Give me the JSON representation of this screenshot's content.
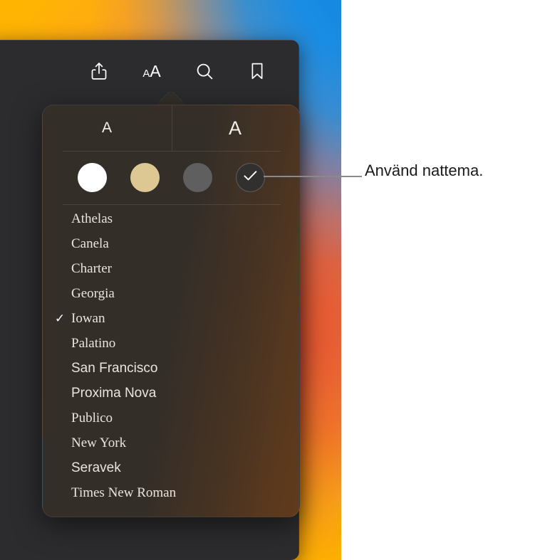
{
  "window": {
    "toolbar": {
      "buttons": [
        {
          "name": "share-icon",
          "label": "Dela"
        },
        {
          "name": "text-size-icon",
          "label": "aA"
        },
        {
          "name": "search-icon",
          "label": "Sök"
        },
        {
          "name": "bookmark-icon",
          "label": "Bokmärke"
        }
      ]
    }
  },
  "popover": {
    "size_controls": {
      "decrease_label": "A",
      "increase_label": "A"
    },
    "themes": [
      {
        "name": "white",
        "label": "Vit",
        "color": "#ffffff",
        "selected": false
      },
      {
        "name": "sepia",
        "label": "Sepia",
        "color": "#ddc893",
        "selected": false
      },
      {
        "name": "gray",
        "label": "Grå",
        "color": "#5f5f5f",
        "selected": false
      },
      {
        "name": "night",
        "label": "Natt",
        "color": "#31302e",
        "selected": true
      }
    ],
    "selected_theme": "night",
    "selected_font": "Iowan",
    "check_glyph": "✓",
    "fonts": [
      {
        "label": "Athelas",
        "style": "serif",
        "selected": false
      },
      {
        "label": "Canela",
        "style": "serif",
        "selected": false
      },
      {
        "label": "Charter",
        "style": "serif",
        "selected": false
      },
      {
        "label": "Georgia",
        "style": "serif",
        "selected": false
      },
      {
        "label": "Iowan",
        "style": "serif",
        "selected": true
      },
      {
        "label": "Palatino",
        "style": "serif",
        "selected": false
      },
      {
        "label": "San Francisco",
        "style": "sans",
        "selected": false
      },
      {
        "label": "Proxima Nova",
        "style": "sans",
        "selected": false
      },
      {
        "label": "Publico",
        "style": "serif",
        "selected": false
      },
      {
        "label": "New York",
        "style": "serif",
        "selected": false
      },
      {
        "label": "Seravek",
        "style": "sans",
        "selected": false
      },
      {
        "label": "Times New Roman",
        "style": "serif",
        "selected": false
      }
    ]
  },
  "callout": {
    "text": "Använd nattema."
  },
  "colors": {
    "popover_background": "#342f29",
    "window_background": "#2c2c2e",
    "text_primary": "#e9e5dd",
    "callout_text": "#1b1b1b",
    "callout_line": "#8a8a8a",
    "wallpaper_blue": "#0d86e0",
    "wallpaper_orange": "#e95832",
    "wallpaper_yellow": "#ffb300"
  }
}
